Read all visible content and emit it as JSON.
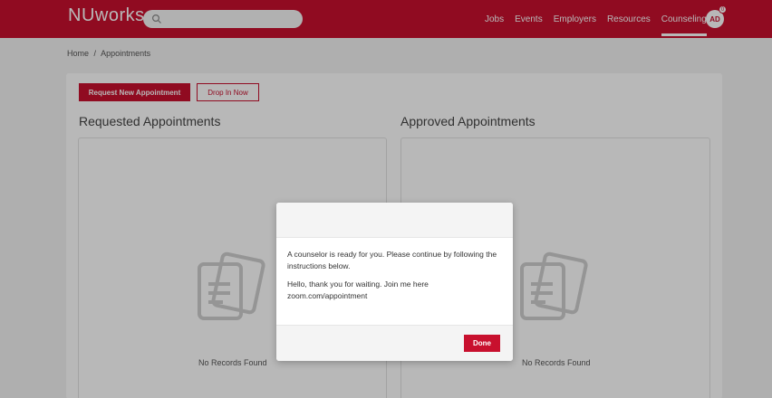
{
  "header": {
    "logo": "NUworks",
    "search_icon": "search-icon",
    "nav": [
      "Jobs",
      "Events",
      "Employers",
      "Resources",
      "Counseling"
    ],
    "active_nav": "Counseling",
    "avatar_initials": "AD",
    "notification_count": "0",
    "brand_color": "#c8102e"
  },
  "breadcrumb": {
    "items": [
      "Home",
      "/",
      "Appointments"
    ]
  },
  "actions": {
    "request_label": "Request New Appointment",
    "dropin_label": "Drop In Now"
  },
  "sections": {
    "requested": {
      "title": "Requested Appointments",
      "empty_text": "No Records Found"
    },
    "approved": {
      "title": "Approved Appointments",
      "empty_text": "No Records Found"
    }
  },
  "modal": {
    "line1": "A counselor is ready for you. Please continue by following the instructions below.",
    "line2": "Hello, thank you for waiting. Join me here zoom.com/appointment",
    "done_label": "Done"
  }
}
